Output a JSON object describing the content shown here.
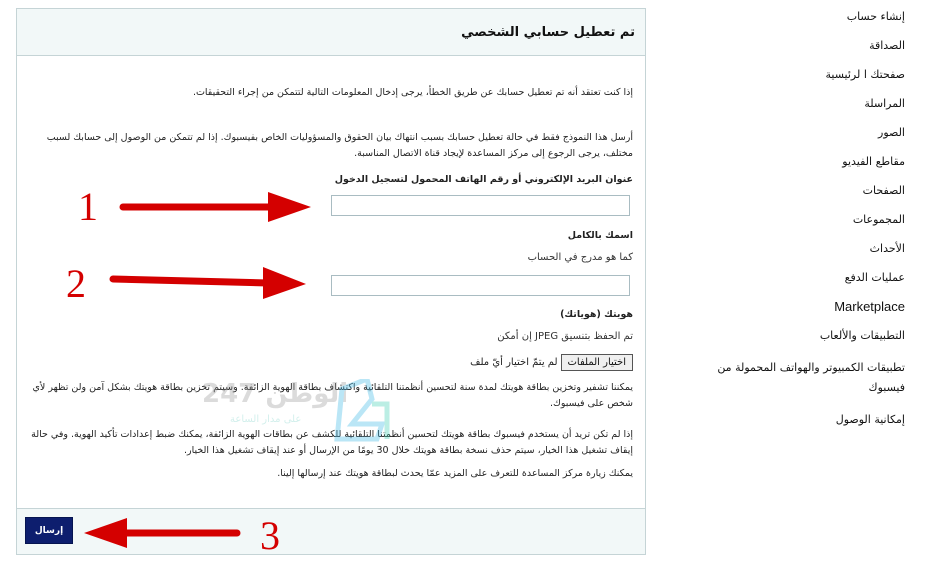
{
  "panel": {
    "title": "تم تعطيل حسابي الشخصي",
    "intro": "إذا كنت تعتقد أنه تم تعطيل حسابك عن طريق الخطأ، يرجى إدخال المعلومات التالية لتتمكن من إجراء التحقيقات.",
    "notice": "أرسل هذا النموذج فقط في حالة تعطيل حسابك بسبب انتهاك بيان الحقوق والمسؤوليات الخاص بفيسبوك. إذا لم تتمكن من الوصول إلى حسابك لسبب مختلف، يرجى الرجوع إلى مركز المساعدة لإيجاد قناة الاتصال المناسبة.",
    "email_label": "عنوان البريد الإلكتروني أو رقم الهاتف المحمول لتسجيل الدخول",
    "email_value": "",
    "name_label": "اسمك بالكامل",
    "name_hint": "كما هو مدرج في الحساب",
    "name_value": "",
    "id_label": "هويتك (هوياتك)",
    "id_hint": "تم الحفظ بتنسيق JPEG إن أمكن",
    "file_button": "اختيار الملفات",
    "file_status": "لم يتمّ اختيار أيّ ملف",
    "para_store": "يمكننا تشفير وتخزين بطاقة هويتك لمدة سنة لتحسين أنظمتنا التلقائية واكتشاف بطاقة الهوية الزائفة. وسيتم تخزين بطاقة هويتك بشكل آمن ولن تظهر لأي شخص على فيسبوك.",
    "para_optout": "إذا لم تكن تريد أن يستخدم فيسبوك بطاقة هويتك لتحسين أنظمتنا التلقائية للكشف عن بطاقات الهوية الزائفة، يمكنك ضبط إعدادات تأكيد الهوية. وفي حالة إيقاف تشغيل هذا الخيار، سيتم حذف نسخة بطاقة هويتك خلال 30 يومًا من الإرسال أو عند إيقاف تشغيل هذا الخيار.",
    "para_help": "يمكنك زيارة مركز المساعدة للتعرف على المزيد عمّا يحدث لبطاقة هويتك عند إرسالها إلينا.",
    "submit": "إرسال"
  },
  "watermark": {
    "text": "الوطن 247",
    "sub": "على مدار الساعة"
  },
  "sidebar": {
    "items": [
      {
        "label": "إنشاء حساب"
      },
      {
        "label": "الصداقة"
      },
      {
        "label": "صفحتك ا لرئيسية"
      },
      {
        "label": "المراسلة"
      },
      {
        "label": "الصور"
      },
      {
        "label": "مقاطع الفيديو"
      },
      {
        "label": "الصفحات"
      },
      {
        "label": "المجموعات"
      },
      {
        "label": "الأحداث"
      },
      {
        "label": "عمليات الدفع"
      },
      {
        "label": "Marketplace"
      },
      {
        "label": "التطبيقات والألعاب"
      },
      {
        "label": "تطبيقات الكمبيوتر والهواتف المحمولة من فيسبوك"
      },
      {
        "label": "إمكانية الوصول"
      }
    ]
  },
  "annotations": {
    "step1": "1",
    "step2": "2",
    "step3": "3",
    "color": "#d40000"
  }
}
